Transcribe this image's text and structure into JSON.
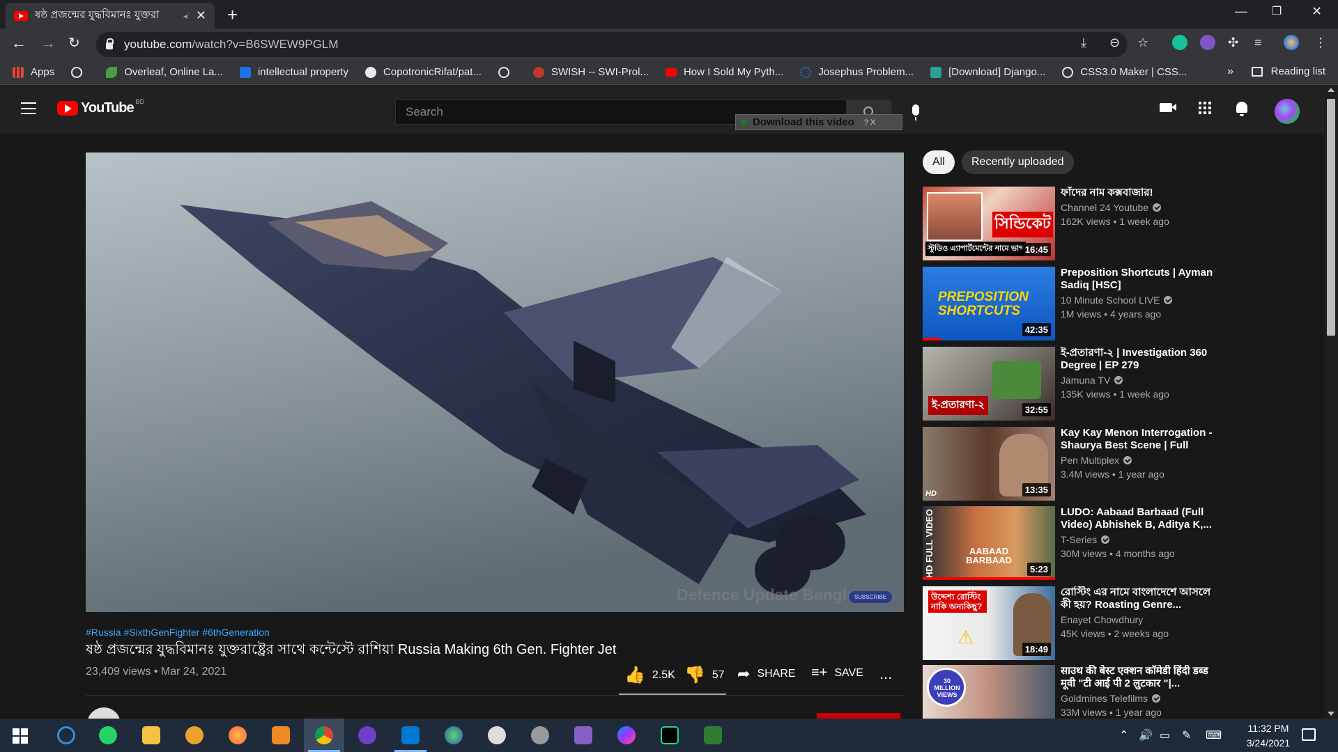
{
  "browser": {
    "tab_title": "ষষ্ঠ প্রজন্মের যুদ্ধবিমানঃ যুক্তরা",
    "url_host": "youtube.com",
    "url_path": "/watch?v=B6SWEW9PGLM",
    "bookmarks": [
      {
        "label": "Apps",
        "color": "#ea4335"
      },
      {
        "label": "",
        "color": "#e8eaed"
      },
      {
        "label": "Overleaf, Online La...",
        "color": "#47a141"
      },
      {
        "label": "intellectual property",
        "color": "#1a73e8"
      },
      {
        "label": "CopotronicRifat/pat...",
        "color": "#e8eaed"
      },
      {
        "label": "",
        "color": "#e8eaed"
      },
      {
        "label": "SWISH -- SWI-Prol...",
        "color": "#c0392b"
      },
      {
        "label": "How I Sold My Pyth...",
        "color": "#ff0000"
      },
      {
        "label": "Josephus Problem...",
        "color": "#1a73e8"
      },
      {
        "label": "[Download] Django...",
        "color": "#2aa198"
      },
      {
        "label": "CSS3.0 Maker | CSS...",
        "color": "#e8eaed"
      }
    ],
    "reading_list": "Reading list",
    "more": "»"
  },
  "youtube": {
    "logo_text": "YouTube",
    "country_code": "BD",
    "search_placeholder": "Search",
    "download_bar": "Download this video",
    "download_bar_extra": "? X",
    "filters": [
      "All",
      "Recently uploaded"
    ]
  },
  "video": {
    "hashtags": "#Russia #SixthGenFighter #6thGeneration",
    "title": "ষষ্ঠ প্রজন্মের যুদ্ধবিমানঃ যুক্তরাষ্ট্রের সাথে কন্টেস্টে রাশিয়া Russia Making 6th Gen. Fighter Jet",
    "meta": "23,409 views • Mar 24, 2021",
    "likes": "2.5K",
    "dislikes": "57",
    "share": "SHARE",
    "save": "SAVE",
    "more": "...",
    "like_ratio": 0.98,
    "watermark": "Defence Update Bangla",
    "subscribe_badge": "SUBSCRIBE"
  },
  "recommendations": [
    {
      "title": "ফাঁদের নাম কক্সবাজার!",
      "channel": "Channel 24 Youtube",
      "views": "162K views • 1 week ago",
      "duration": "16:45",
      "thumb_text": "স্টুডিও এ্যাপার্টমেন্টের নামে ভাগ"
    },
    {
      "title": "Preposition Shortcuts | Ayman Sadiq [HSC]",
      "channel": "10 Minute School LIVE",
      "views": "1M views • 4 years ago",
      "duration": "42:35",
      "thumb_text": "PREPOSITION SHORTCUTS"
    },
    {
      "title": "ই-প্রতারণা-২ | Investigation 360 Degree | EP 279",
      "channel": "Jamuna TV",
      "views": "135K views • 1 week ago",
      "duration": "32:55",
      "thumb_text": "ই-প্রতারণা-২"
    },
    {
      "title": "Kay Kay Menon Interrogation - Shaurya Best Scene | Full Hind...",
      "channel": "Pen Multiplex",
      "views": "3.4M views • 1 year ago",
      "duration": "13:35",
      "thumb_text": "HD"
    },
    {
      "title": "LUDO: Aabaad Barbaad (Full Video) Abhishek B, Aditya K,...",
      "channel": "T-Series",
      "views": "30M views • 4 months ago",
      "duration": "5:23",
      "thumb_text": "AABAAD BARBAAD"
    },
    {
      "title": "রোস্টিং এর নামে বাংলাদেশে আসলে কী হয়? Roasting Genre...",
      "channel": "Enayet Chowdhury",
      "views": "45K views • 2 weeks ago",
      "duration": "18:49",
      "thumb_text": "উদ্দেশ্য রোস্টিং নাকি অন্যকিছু?"
    },
    {
      "title": "साउथ की बेस्ट एक्शन कॉमेडी हिंदी डब्ड मूवी \"टी आई पी 2 लुटकार \"|...",
      "channel": "Goldmines Telefilms",
      "views": "33M views • 1 year ago",
      "duration": "",
      "thumb_text": "30 MILLION VIEWS"
    }
  ],
  "taskbar": {
    "time": "11:32 PM",
    "date": "3/24/2021"
  }
}
